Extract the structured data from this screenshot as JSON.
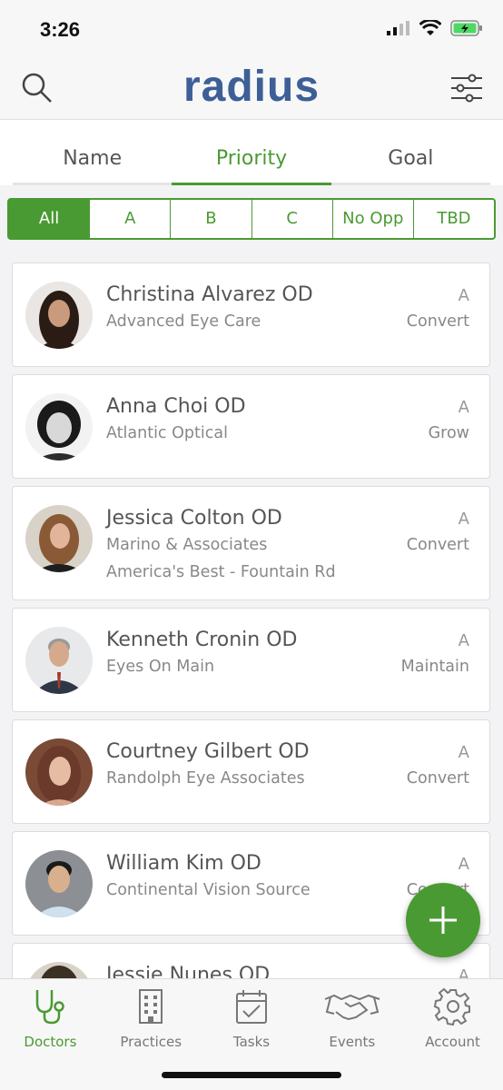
{
  "status": {
    "time": "3:26"
  },
  "header": {
    "logo": "radius"
  },
  "tabs": [
    {
      "label": "Name",
      "active": false
    },
    {
      "label": "Priority",
      "active": true
    },
    {
      "label": "Goal",
      "active": false
    }
  ],
  "segments": [
    {
      "label": "All",
      "active": true
    },
    {
      "label": "A",
      "active": false
    },
    {
      "label": "B",
      "active": false
    },
    {
      "label": "C",
      "active": false
    },
    {
      "label": "No Opp",
      "active": false
    },
    {
      "label": "TBD",
      "active": false
    }
  ],
  "doctors": [
    {
      "name": "Christina Alvarez OD",
      "practice": "Advanced Eye Care",
      "practice2": "",
      "priority": "A",
      "goal": "Convert",
      "avatar_color": "#3a2a22"
    },
    {
      "name": "Anna Choi OD",
      "practice": "Atlantic Optical",
      "practice2": "",
      "priority": "A",
      "goal": "Grow",
      "avatar_color": "#2b2b2b"
    },
    {
      "name": "Jessica Colton OD",
      "practice": "Marino & Associates",
      "practice2": "America's Best - Fountain Rd",
      "priority": "A",
      "goal": "Convert",
      "avatar_color": "#8a5a36"
    },
    {
      "name": "Kenneth Cronin OD",
      "practice": "Eyes On Main",
      "practice2": "",
      "priority": "A",
      "goal": "Maintain",
      "avatar_color": "#3b4350"
    },
    {
      "name": "Courtney Gilbert OD",
      "practice": "Randolph Eye Associates",
      "practice2": "",
      "priority": "A",
      "goal": "Convert",
      "avatar_color": "#6b3a2a"
    },
    {
      "name": "William Kim OD",
      "practice": "Continental Vision Source",
      "practice2": "",
      "priority": "A",
      "goal": "Convert",
      "avatar_color": "#2a2a2a"
    },
    {
      "name": "Jessie Nunes OD",
      "practice": "",
      "practice2": "",
      "priority": "A",
      "goal": "",
      "avatar_color": "#3a3024"
    }
  ],
  "tabbar": [
    {
      "label": "Doctors",
      "icon": "stethoscope-icon",
      "active": true
    },
    {
      "label": "Practices",
      "icon": "building-icon",
      "active": false
    },
    {
      "label": "Tasks",
      "icon": "calendar-check-icon",
      "active": false
    },
    {
      "label": "Events",
      "icon": "handshake-icon",
      "active": false
    },
    {
      "label": "Account",
      "icon": "gear-icon",
      "active": false
    }
  ],
  "colors": {
    "accent": "#4a9a33",
    "brand": "#3d5f96"
  }
}
